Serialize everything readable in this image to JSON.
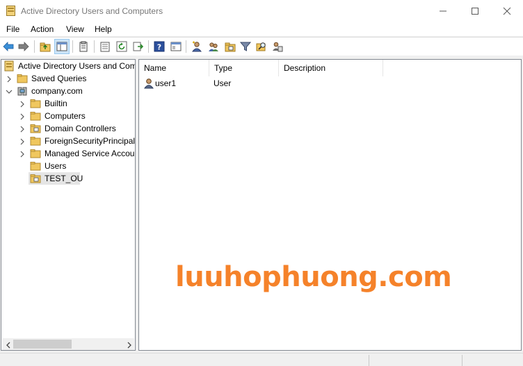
{
  "window": {
    "title": "Active Directory Users and Computers",
    "controls": [
      "minimize",
      "maximize",
      "close"
    ]
  },
  "menu": {
    "items": [
      "File",
      "Action",
      "View",
      "Help"
    ]
  },
  "toolbar": {
    "icons": [
      "back-arrow-icon",
      "forward-arrow-icon",
      "up-folder-icon",
      "show-hide-console-tree-icon",
      "clipboard-icon",
      "properties-icon",
      "refresh-icon",
      "export-list-icon",
      "help-icon",
      "console-view-icon",
      "new-user-icon",
      "new-group-icon",
      "new-ou-icon",
      "filter-icon",
      "find-icon",
      "delegate-control-icon"
    ]
  },
  "tree": {
    "root": "Active Directory Users and Com",
    "saved_queries": "Saved Queries",
    "domain": "company.com",
    "children": [
      "Builtin",
      "Computers",
      "Domain Controllers",
      "ForeignSecurityPrincipals",
      "Managed Service Accour",
      "Users",
      "TEST_OU"
    ],
    "selected": "TEST_OU"
  },
  "list": {
    "columns": [
      "Name",
      "Type",
      "Description"
    ],
    "rows": [
      {
        "name": "user1",
        "type": "User",
        "description": ""
      }
    ]
  },
  "watermark": "luuhophuong.com",
  "colors": {
    "watermark": "#f5822a",
    "selection": "#e5e5e5",
    "toolbar_active": "#cce4f7",
    "folder": "#f0c75e"
  }
}
